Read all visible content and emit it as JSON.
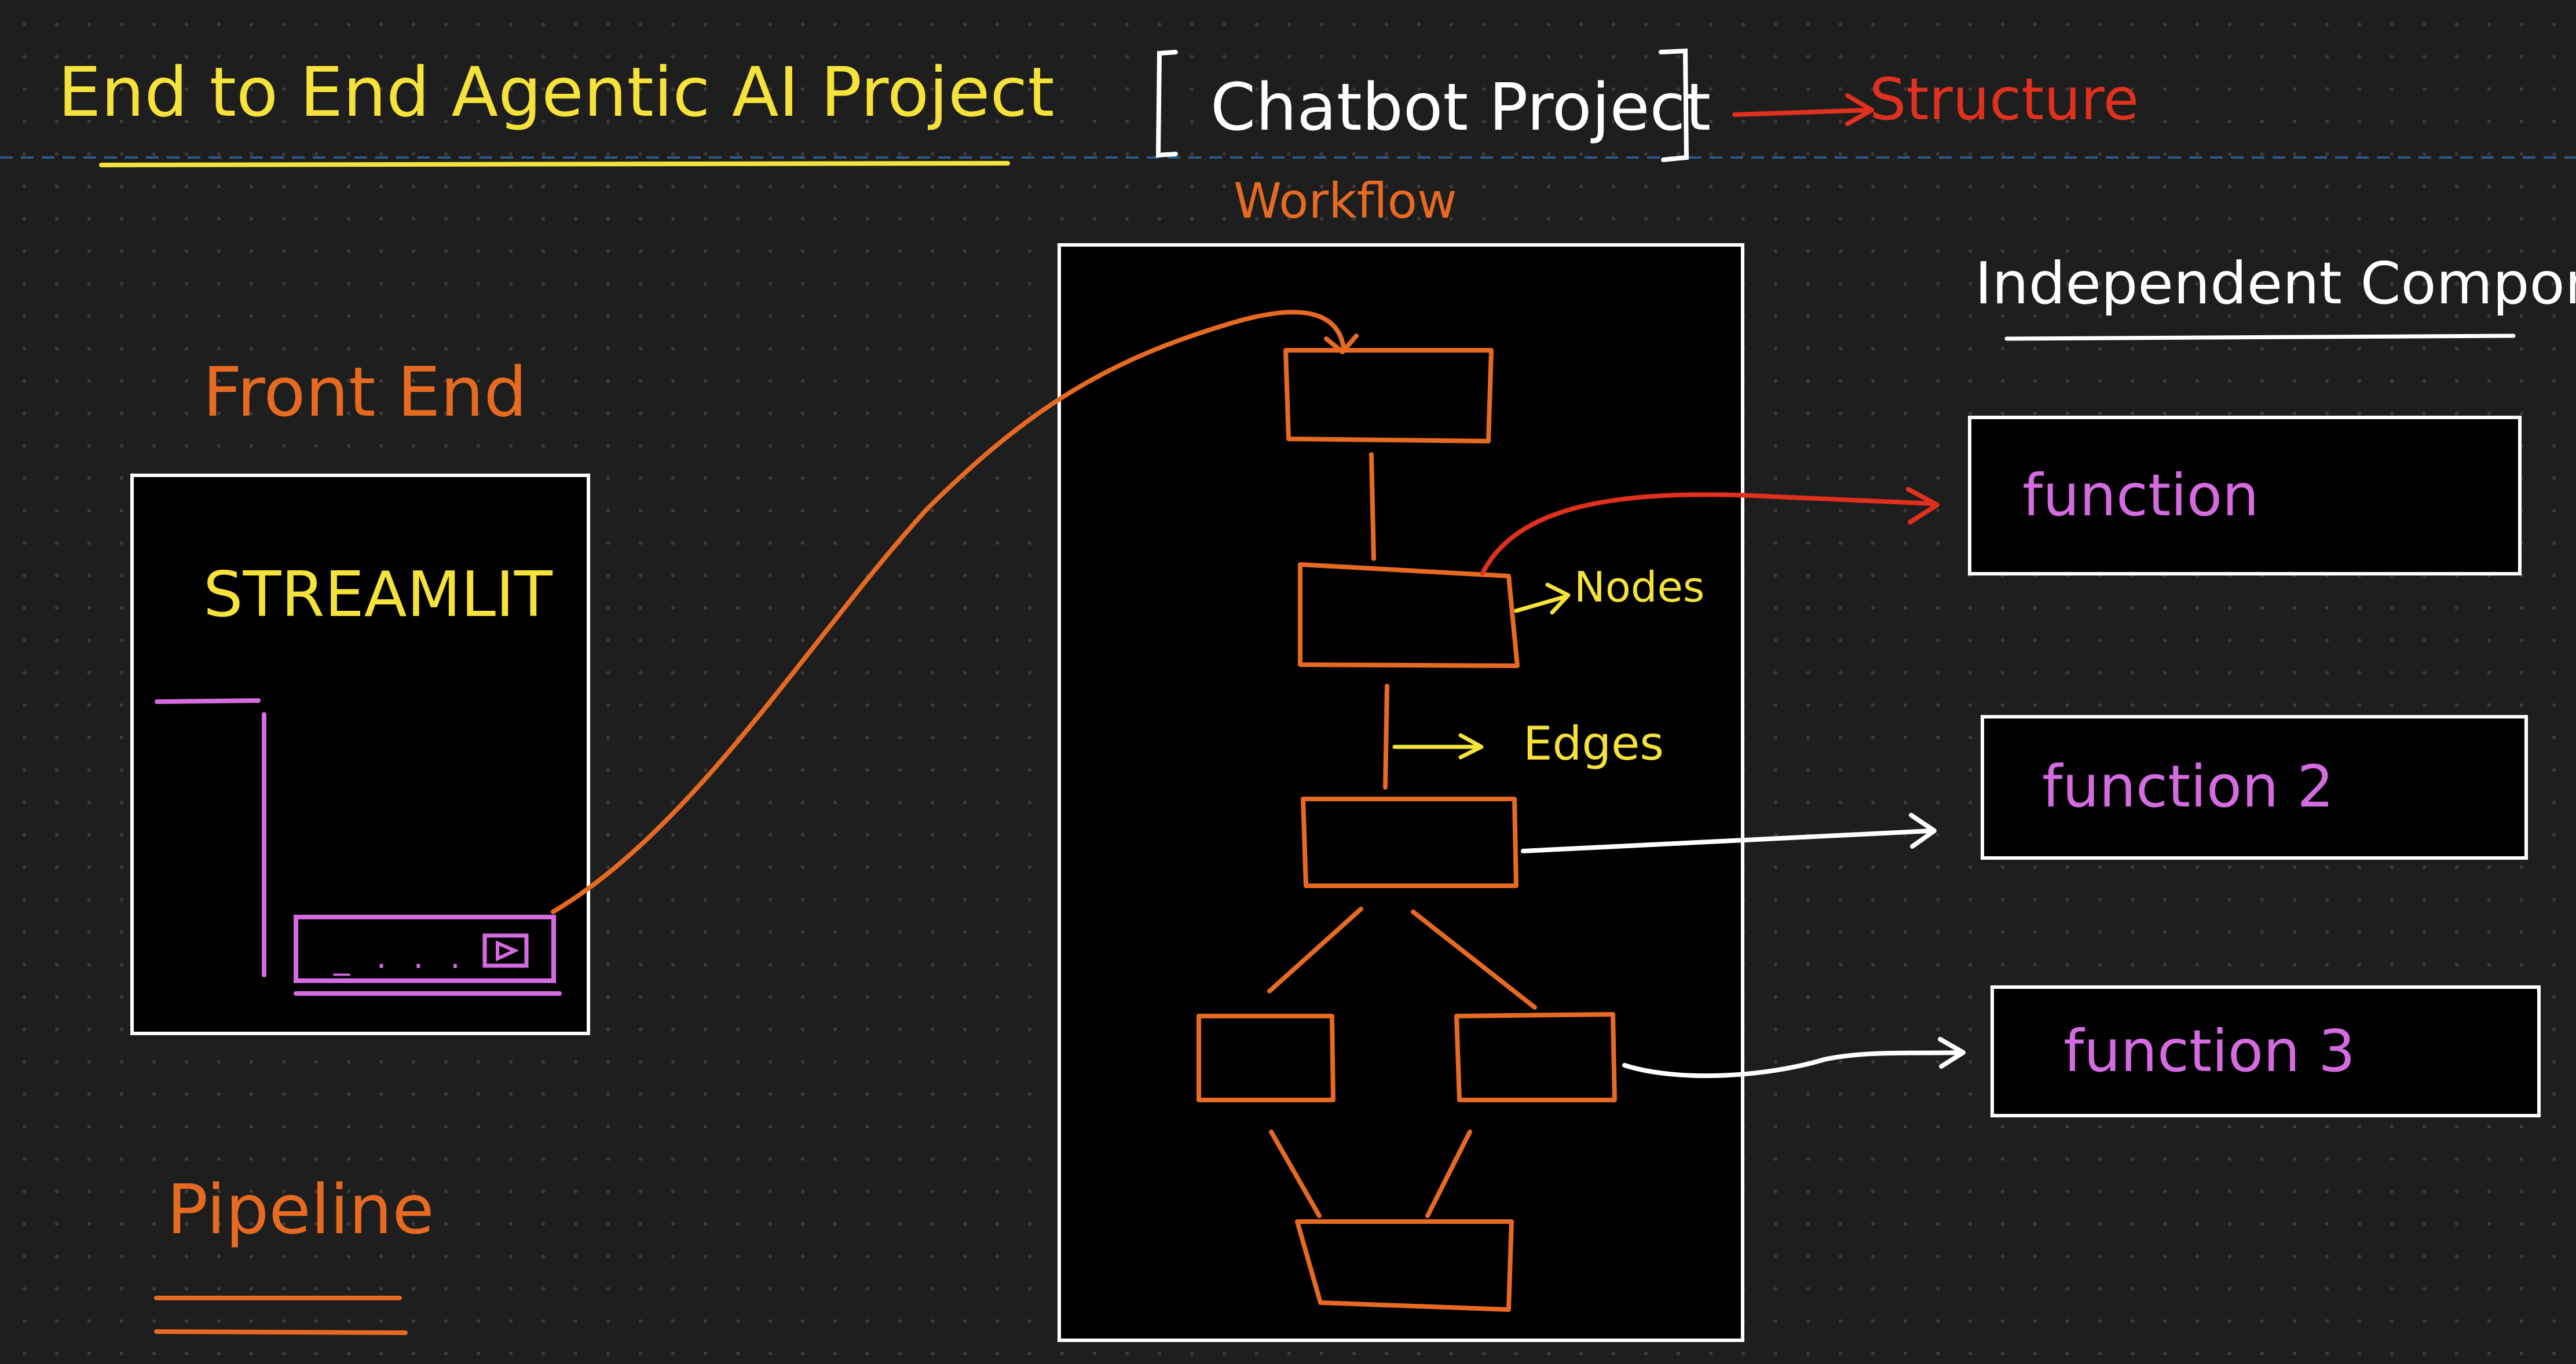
{
  "title": {
    "main": "End to End Agentic AI Project",
    "bracket_text": "Chatbot Project",
    "arrow_target": "Structure"
  },
  "workflow": {
    "label": "Workflow",
    "node_annotation": "Nodes",
    "edge_annotation": "Edges"
  },
  "frontend": {
    "label": "Front End",
    "streamlit_label": "STREAMLIT",
    "input_placeholder": "_ . . ."
  },
  "components": {
    "heading": "Independent Components",
    "items": [
      "function",
      "function 2",
      "function 3"
    ]
  },
  "pipeline": {
    "label": "Pipeline"
  },
  "colors": {
    "background": "#1e1e1e",
    "yellow": "#f5e23a",
    "orange": "#e66a22",
    "red": "#e0301e",
    "pink": "#d56be0",
    "white": "#ffffff"
  }
}
